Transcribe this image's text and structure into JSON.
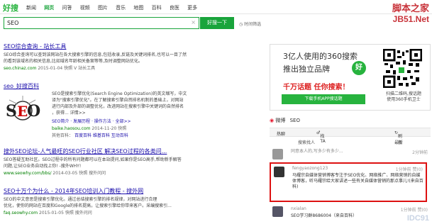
{
  "header": {
    "logo": "好搜",
    "nav": [
      "新闻",
      "网页",
      "问答",
      "视频",
      "图片",
      "音乐",
      "地图",
      "百科",
      "良医",
      "更多"
    ],
    "active_tab": "网页"
  },
  "watermark": {
    "line1": "脚本之家",
    "line2": "JB51.Net"
  },
  "search": {
    "query": "SEO",
    "clear": "×",
    "button": "好搜一下",
    "time_filter": "时间筛选"
  },
  "results": [
    {
      "title": "SEO综合查询 - 站长工具",
      "desc1": "SEO综合查询可以查到该网站在各大搜索引擎的信息,包括收录,反链及关键词排名,也可以一目了然",
      "desc2": "的看到该域名的相关信息,比如域名年龄相关备案等等,及时调整网站优化。",
      "url": "seo.chinaz.com",
      "date": "2015-01-04",
      "cache": "快照",
      "extra": "V 站长工具"
    },
    {
      "title": "seo_好搜百科",
      "desc1": "SEO是搜索引擎优化(Search Engine Optimization)的英文缩写，中文",
      "desc2": "译为\"搜索引擎优化\"。在了解搜索引擎自然排名机制的基础上，对网站",
      "desc3": "进行内部及外部的调整优化，改进网站在搜索引擎中关键词的自然排名",
      "desc4": "，获得... 详情>>",
      "links": "SEO简介 · 发展历程 · 操作方法 · 全部>>",
      "url": "baike.haosou.com",
      "date": "2014-11-20",
      "cache": "快照",
      "other_label": "其他百科：",
      "others": "百度百科   维基百科   互动百科",
      "image_text": "SEO"
    },
    {
      "title": "搜外SEO论坛-人气最旺的SEO行业社区 解决SEO过程的各类问...",
      "desc1": "SEO答疑互助社区。SEO过程中的所有问题都可以在本站提问,如果你是SEO高手,帮助新手解答",
      "desc2": "问题,让SEO业务自动找上你! -搜外WHY!",
      "url": "www.seowhy.com/bbs/",
      "date": "2014-03-05",
      "cache": "快照",
      "extra": "搜外问问"
    },
    {
      "title": "SEO十万个为什么 - 2014年SEO培训入门教程 - 搜外网",
      "desc1": "SEO的中文意思是搜索引擎优化。通过总结搜索引擎的排名规律，对网站进行合理",
      "desc2": "优化，使你的网站在百度和Google的排名提高，让搜索引擎给你带来客户。采编搜索引...",
      "url": "faq.seowhy.com",
      "date": "2015-01-05",
      "cache": "快照",
      "extra": "搜外问问"
    }
  ],
  "ad": {
    "line1": "3亿人使用的360搜索",
    "line2": "推出独立品牌",
    "badge": "好",
    "line3": "千万话题  任你搜索！",
    "button": "下载手机APP搜话题",
    "qr_caption1": "扫描二维码,搜话题",
    "qr_caption2": "使用360手机卫士"
  },
  "weibo": {
    "source": "微博",
    "topic": "SEO",
    "tabs": {
      "hot": "热聊",
      "find": "找TA",
      "refresh": "刷新"
    },
    "tools": {
      "label": "搜索找人",
      "time": "最新"
    },
    "posts": [
      {
        "user": "嘿pr.ccc",
        "text": "同意本人的,写多少有多少...",
        "time": "2分钟前",
        "likes": "(0)"
      },
      {
        "user": "fengyaozong123",
        "text": "马耀宗自媒体营销博客专注于SEO优化、网络推广、网络营销的自媒体博客，听马耀宗给大家讲述一些有关自媒体营销的那点事儿!(来自百科)",
        "time": "1分钟前",
        "likes": "(0)"
      },
      {
        "user": "nxialan",
        "text": "SEO学习群8686004（来自百科）",
        "time": "1分钟前",
        "likes": "(0)"
      }
    ],
    "corner": "IDC91"
  },
  "colors": {
    "green": "#19a43b",
    "link": "#1a0dab",
    "url": "#008000",
    "highlight_red": "#c00",
    "box_red": "#d11"
  }
}
